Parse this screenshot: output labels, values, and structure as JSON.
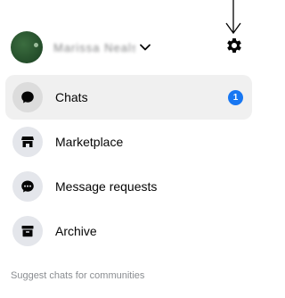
{
  "header": {
    "account_name": "Marissa Neals",
    "account_switch_icon": "chevron-down-icon",
    "settings_icon": "gear-icon",
    "avatar_color": "#2f5d34"
  },
  "annotation": {
    "icon": "arrow-down-icon"
  },
  "menu": {
    "items": [
      {
        "label": "Chats",
        "icon": "chat-bubble-icon",
        "active": true,
        "badge": "1"
      },
      {
        "label": "Marketplace",
        "icon": "storefront-icon",
        "active": false
      },
      {
        "label": "Message requests",
        "icon": "message-requests-icon",
        "active": false
      },
      {
        "label": "Archive",
        "icon": "archive-box-icon",
        "active": false
      }
    ]
  },
  "sections": {
    "communities_heading": "Suggest chats for communities"
  },
  "colors": {
    "badge": "#1877f2",
    "active_row_bg": "#f0f0f0",
    "icon_circle_bg": "#e4e6eb",
    "muted_text": "#8a8d91"
  }
}
